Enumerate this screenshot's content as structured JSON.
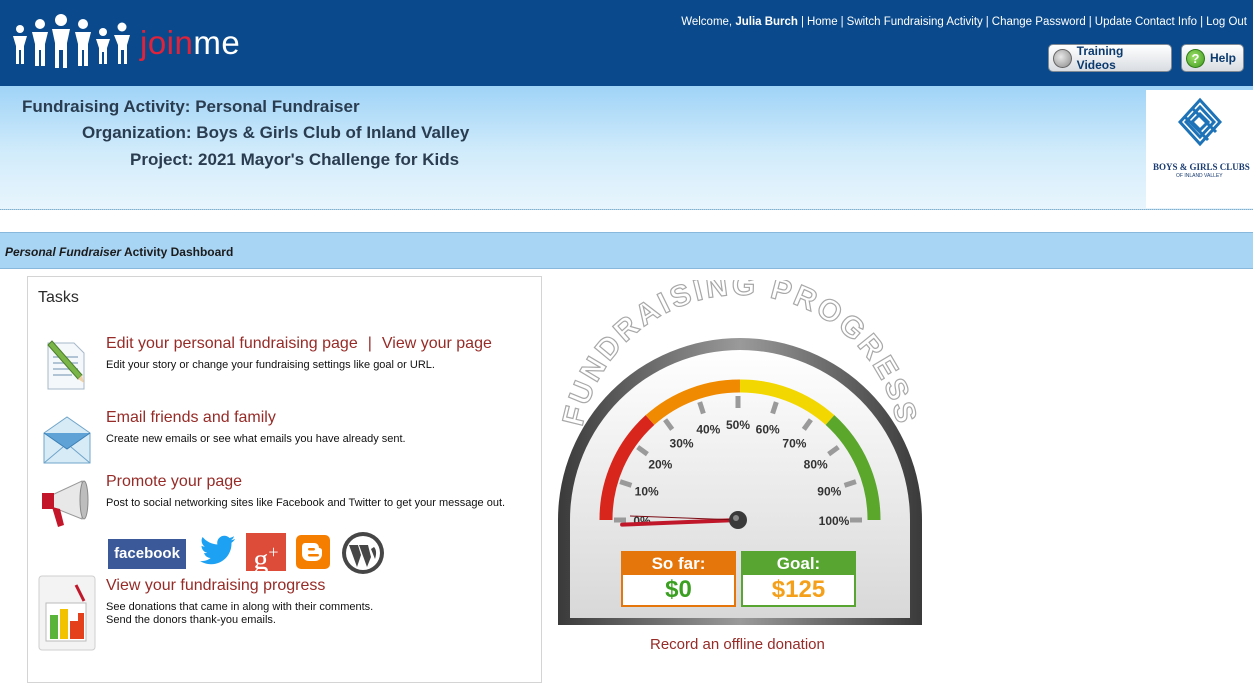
{
  "header": {
    "brand_join": "join",
    "brand_me": "me",
    "welcome_prefix": "Welcome,",
    "user_name": "Julia Burch",
    "links": [
      "Home",
      "Switch Fundraising Activity",
      "Change Password",
      "Update Contact Info",
      "Log Out"
    ],
    "training_label": "Training Videos",
    "help_label": "Help"
  },
  "info": {
    "activity_label": "Fundraising Activity:",
    "activity_value": "Personal Fundraiser",
    "org_label": "Organization:",
    "org_value": "Boys & Girls Club of Inland Valley",
    "project_label": "Project:",
    "project_value": "2021 Mayor's Challenge for Kids",
    "org_logo_name": "BOYS & GIRLS CLUBS",
    "org_logo_sub": "OF INLAND VALLEY"
  },
  "section": {
    "title_italic": "Personal Fundraiser",
    "title_rest": "Activity Dashboard"
  },
  "tasks": {
    "title": "Tasks",
    "edit_link": "Edit your personal fundraising page",
    "view_link": "View your page",
    "edit_desc": "Edit your story or change your fundraising settings like goal or URL.",
    "email_link": "Email friends and family",
    "email_desc": "Create new emails or see what emails you have already sent.",
    "promote_link": "Promote your page",
    "promote_desc": "Post to social networking sites like Facebook and Twitter to get your message out.",
    "facebook_label": "facebook",
    "progress_link": "View your fundraising progress",
    "progress_desc_1": "See donations that came in along with their comments.",
    "progress_desc_2": "Send the donors thank-you emails."
  },
  "gauge": {
    "arc_title": "FUNDRAISING PROGRESS",
    "ticks": [
      "0%",
      "10%",
      "20%",
      "30%",
      "40%",
      "50%",
      "60%",
      "70%",
      "80%",
      "90%",
      "100%"
    ],
    "progress_percent": 0,
    "so_far_label": "So far:",
    "so_far_value": "$0",
    "goal_label": "Goal:",
    "goal_value": "$125",
    "offline_link": "Record an offline donation",
    "colors": {
      "red": "#d9261c",
      "orange": "#f08a00",
      "yellow": "#f2d700",
      "green": "#5aa72c",
      "needle": "#c0182a"
    }
  }
}
